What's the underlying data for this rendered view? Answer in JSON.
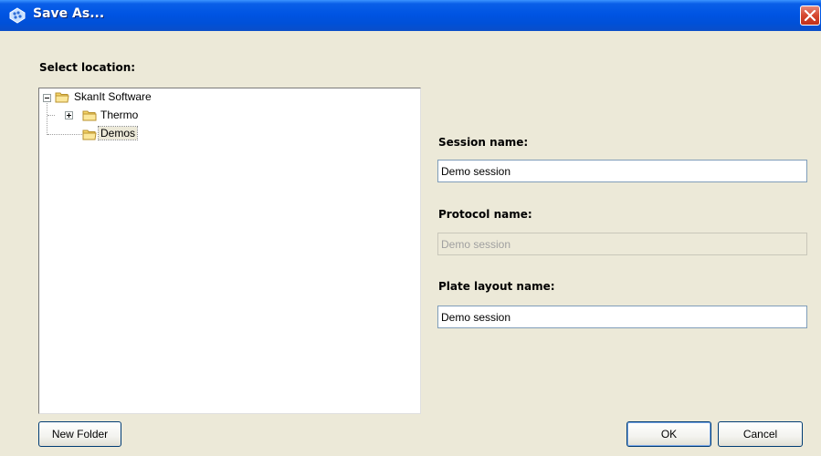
{
  "window": {
    "title": "Save As..."
  },
  "location": {
    "label": "Select location:",
    "tree": {
      "root": "SkanIt Software",
      "children": [
        {
          "label": "Thermo",
          "expandable": true
        },
        {
          "label": "Demos",
          "selected": true
        }
      ]
    }
  },
  "session": {
    "label": "Session name:",
    "value": "Demo session"
  },
  "protocol": {
    "label": "Protocol name:",
    "value": "Demo session",
    "disabled": true
  },
  "plate_layout": {
    "label": "Plate layout name:",
    "value": "Demo session"
  },
  "buttons": {
    "new_folder": "New Folder",
    "ok": "OK",
    "cancel": "Cancel"
  },
  "colors": {
    "titlebar": "#0054e3",
    "dialog_bg": "#ece9d8",
    "close": "#d6472e"
  }
}
